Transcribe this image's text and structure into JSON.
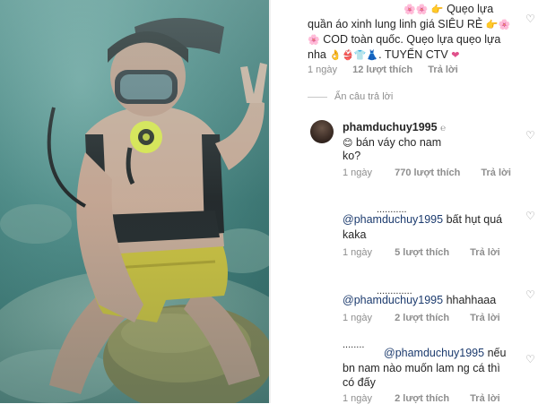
{
  "photo": {
    "alt": ""
  },
  "top_comment": {
    "line1_text": "Quẹo lựa",
    "line2": "quần áo xinh lung linh giá SIÊU RẺ",
    "line3": "COD toàn quốc. Quẹo lựa quẹo lựa",
    "line4_start": "nha",
    "line4_end": ". TUYỂN CTV",
    "time": "1 ngày",
    "likes": "12 lượt thích",
    "reply": "Trả lời"
  },
  "hide_replies": "Ẩn câu trả lời",
  "replies": [
    {
      "username": "phamduchuy1995",
      "badge": "℮",
      "text_line1": "bán váy cho nam",
      "text_line2": "ko?",
      "time": "1 ngày",
      "likes": "770 lượt thích",
      "reply": "Trả lời"
    },
    {
      "mention": "@phamduchuy1995",
      "text_line1": "bất hụt quá",
      "text_line2": "kaka",
      "time": "1 ngày",
      "likes": "5 lượt thích",
      "reply": "Trả lời"
    },
    {
      "mention": "@phamduchuy1995",
      "text_line1": "hhahhaaa",
      "time": "1 ngày",
      "likes": "2 lượt thích",
      "reply": "Trả lời"
    },
    {
      "mention": "@phamduchuy1995",
      "text_line1": "nếu",
      "text_line2": "bn nam nào muốn lam ng cá thì",
      "text_line3": "có đấy",
      "time": "1 ngày",
      "likes": "2 lượt thích",
      "reply": "Trả lời"
    }
  ],
  "colors": {
    "text": "#262626",
    "muted": "#8e8e8e",
    "mention": "#1c3b6e",
    "heart_emoji": "#e0508a"
  },
  "icons": {
    "like": "heart-outline-icon",
    "emoji_flowers": "cherry-blossom-emoji",
    "emoji_point": "pointing-hand-emoji"
  }
}
